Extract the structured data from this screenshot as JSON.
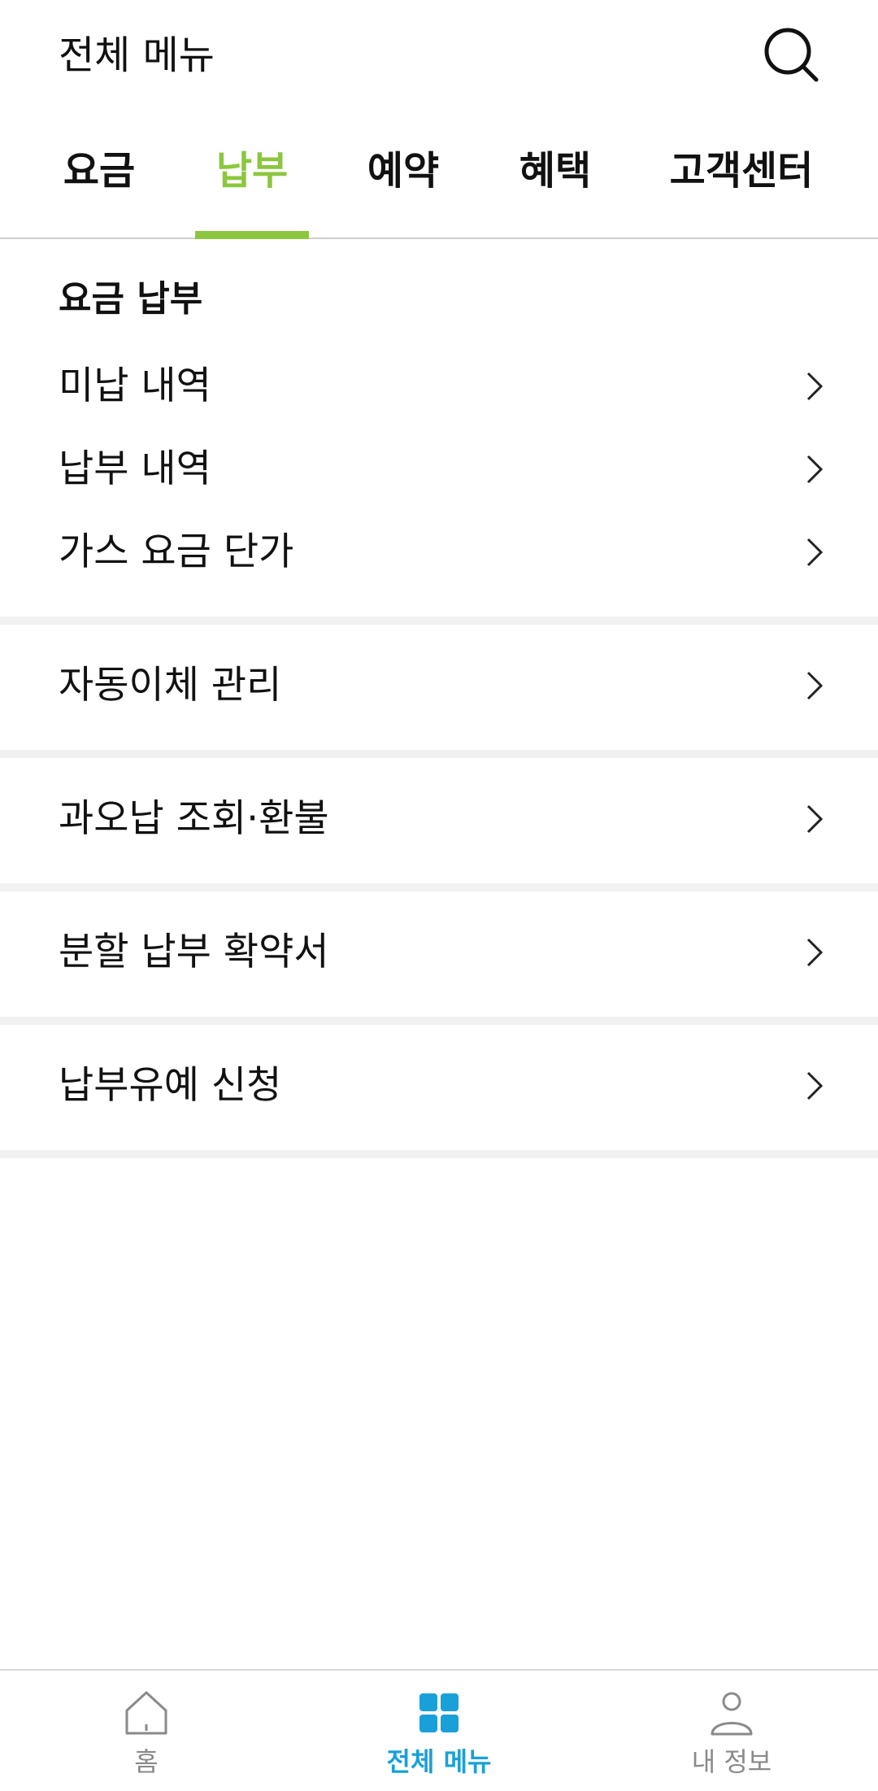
{
  "header": {
    "title": "전체 메뉴",
    "search_icon": "search-icon"
  },
  "tabs": [
    {
      "label": "요금",
      "active": false
    },
    {
      "label": "납부",
      "active": true
    },
    {
      "label": "예약",
      "active": false
    },
    {
      "label": "혜택",
      "active": false
    },
    {
      "label": "고객센터",
      "active": false
    }
  ],
  "section": {
    "title": "요금 납부",
    "items": [
      {
        "label": "미납 내역"
      },
      {
        "label": "납부 내역"
      },
      {
        "label": "가스 요금 단가"
      }
    ]
  },
  "menu_groups": [
    {
      "label": "자동이체 관리"
    },
    {
      "label": "과오납 조회·환불"
    },
    {
      "label": "분할 납부 확약서"
    },
    {
      "label": "납부유예 신청"
    }
  ],
  "bottom_nav": [
    {
      "label": "홈",
      "icon": "home-icon",
      "active": false
    },
    {
      "label": "전체 메뉴",
      "icon": "grid-icon",
      "active": true
    },
    {
      "label": "내 정보",
      "icon": "person-icon",
      "active": false
    }
  ],
  "colors": {
    "accent_green": "#8cc63f",
    "accent_blue": "#1aa0d8",
    "divider": "#f1f1f1"
  }
}
